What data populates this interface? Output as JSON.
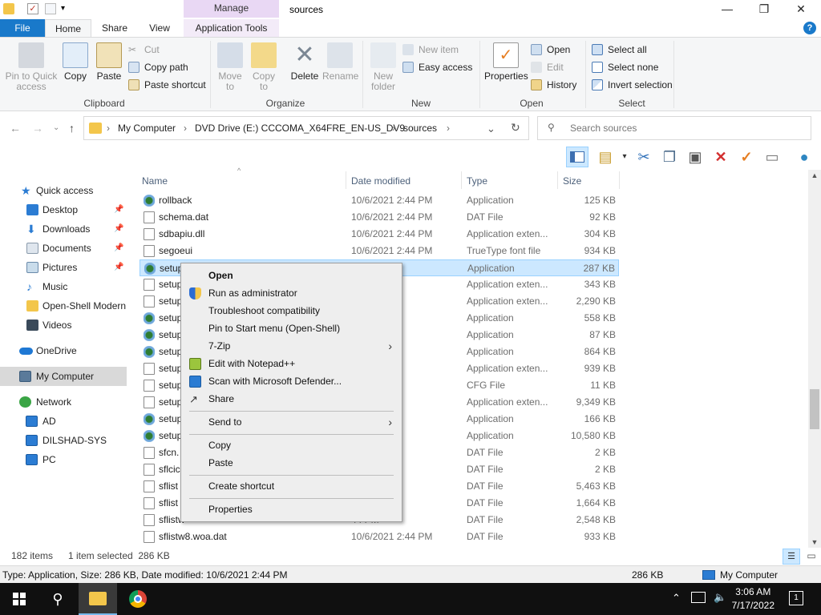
{
  "window": {
    "title": "sources",
    "contextual_tab_header": "Manage",
    "minimize_icon": "—",
    "maximize_icon": "❐",
    "close_icon": "✕",
    "help_icon": "?"
  },
  "ribbon_tabs": [
    "File",
    "Home",
    "Share",
    "View",
    "Application Tools"
  ],
  "ribbon": {
    "clipboard": {
      "label": "Clipboard",
      "pin_quick_access": "Pin to Quick access",
      "copy": "Copy",
      "paste": "Paste",
      "cut": "Cut",
      "copy_path": "Copy path",
      "paste_shortcut": "Paste shortcut"
    },
    "organize": {
      "label": "Organize",
      "move_to": "Move to",
      "copy_to": "Copy to",
      "delete": "Delete",
      "rename": "Rename"
    },
    "new": {
      "label": "New",
      "new_folder": "New folder",
      "new_item": "New item",
      "easy_access": "Easy access"
    },
    "open": {
      "label": "Open",
      "properties": "Properties",
      "open": "Open",
      "edit": "Edit",
      "history": "History"
    },
    "select": {
      "label": "Select",
      "select_all": "Select all",
      "select_none": "Select none",
      "invert_selection": "Invert selection"
    }
  },
  "address": {
    "crumbs": [
      "My Computer",
      "DVD Drive (E:) CCCOMA_X64FRE_EN-US_DV9",
      "sources"
    ],
    "search_placeholder": "Search sources"
  },
  "nav_pane": {
    "items": [
      {
        "label": "Quick access",
        "icon": "star-icon"
      },
      {
        "label": "Desktop",
        "icon": "desktop-icon"
      },
      {
        "label": "Downloads",
        "icon": "download-icon"
      },
      {
        "label": "Documents",
        "icon": "documents-icon"
      },
      {
        "label": "Pictures",
        "icon": "pictures-icon"
      },
      {
        "label": "Music",
        "icon": "music-icon"
      },
      {
        "label": "Open-Shell Modern",
        "icon": "folder-icon"
      },
      {
        "label": "Videos",
        "icon": "videos-icon"
      },
      {
        "label": "OneDrive",
        "icon": "cloud-icon"
      },
      {
        "label": "My Computer",
        "icon": "computer-icon"
      },
      {
        "label": "Network",
        "icon": "network-icon"
      },
      {
        "label": "AD",
        "icon": "monitor-icon"
      },
      {
        "label": "DILSHAD-SYS",
        "icon": "monitor-icon"
      },
      {
        "label": "PC",
        "icon": "monitor-icon"
      }
    ]
  },
  "file_list": {
    "columns": [
      "Name",
      "Date modified",
      "Type",
      "Size"
    ],
    "rows": [
      {
        "name": "rollback",
        "date": "10/6/2021 2:44 PM",
        "type": "Application",
        "size": "125 KB"
      },
      {
        "name": "schema.dat",
        "date": "10/6/2021 2:44 PM",
        "type": "DAT File",
        "size": "92 KB"
      },
      {
        "name": "sdbapiu.dll",
        "date": "10/6/2021 2:44 PM",
        "type": "Application exten...",
        "size": "304 KB"
      },
      {
        "name": "segoeui",
        "date": "10/6/2021 2:44 PM",
        "type": "TrueType font file",
        "size": "934 KB"
      },
      {
        "name": "setup",
        "date": "44 PM",
        "type": "Application",
        "size": "287 KB"
      },
      {
        "name": "setup",
        "date": "44 PM",
        "type": "Application exten...",
        "size": "343 KB"
      },
      {
        "name": "setup",
        "date": "44 PM",
        "type": "Application exten...",
        "size": "2,290 KB"
      },
      {
        "name": "setup",
        "date": "44 PM",
        "type": "Application",
        "size": "558 KB"
      },
      {
        "name": "setup",
        "date": "44 PM",
        "type": "Application",
        "size": "87 KB"
      },
      {
        "name": "setup",
        "date": "44 PM",
        "type": "Application",
        "size": "864 KB"
      },
      {
        "name": "setup",
        "date": "44 PM",
        "type": "Application exten...",
        "size": "939 KB"
      },
      {
        "name": "setup",
        "date": "44 PM",
        "type": "CFG File",
        "size": "11 KB"
      },
      {
        "name": "setup",
        "date": "44 PM",
        "type": "Application exten...",
        "size": "9,349 KB"
      },
      {
        "name": "setup",
        "date": "44 PM",
        "type": "Application",
        "size": "166 KB"
      },
      {
        "name": "setup",
        "date": "44 PM",
        "type": "Application",
        "size": "10,580 KB"
      },
      {
        "name": "sfcn.",
        "date": "44 PM",
        "type": "DAT File",
        "size": "2 KB"
      },
      {
        "name": "sflcic",
        "date": "44 PM",
        "type": "DAT File",
        "size": "2 KB"
      },
      {
        "name": "sflist",
        "date": "44 PM",
        "type": "DAT File",
        "size": "5,463 KB"
      },
      {
        "name": "sflist",
        "date": "44 PM",
        "type": "DAT File",
        "size": "1,664 KB"
      },
      {
        "name": "sflistw",
        "date": "44 PM",
        "type": "DAT File",
        "size": "2,548 KB"
      },
      {
        "name": "sflistw8.woa.dat",
        "date": "10/6/2021 2:44 PM",
        "type": "DAT File",
        "size": "933 KB"
      }
    ]
  },
  "context_menu": {
    "items": [
      {
        "label": "Open",
        "bold": true
      },
      {
        "label": "Run as administrator",
        "icon": "shield-icon"
      },
      {
        "label": "Troubleshoot compatibility"
      },
      {
        "label": "Pin to Start menu (Open-Shell)"
      },
      {
        "label": "7-Zip",
        "submenu": true
      },
      {
        "label": "Edit with Notepad++",
        "icon": "notepad-icon"
      },
      {
        "label": "Scan with Microsoft Defender...",
        "icon": "defender-icon"
      },
      {
        "label": "Share",
        "icon": "share-icon"
      },
      {
        "label": "Send to",
        "submenu": true
      },
      {
        "label": "Copy"
      },
      {
        "label": "Paste"
      },
      {
        "label": "Create shortcut"
      },
      {
        "label": "Properties"
      }
    ],
    "submenu_arrow": "›"
  },
  "status": {
    "item_count": "182 items",
    "selected": "1 item selected  286 KB"
  },
  "details_bar": {
    "info": "Type: Application, Size: 286 KB, Date modified: 10/6/2021 2:44 PM",
    "size": "286 KB",
    "location": "My Computer"
  },
  "taskbar": {
    "time": "3:06 AM",
    "date": "7/17/2022",
    "notification_count": "1"
  },
  "colors": {
    "file_tab": "#1979ca",
    "selection": "#cce8ff",
    "context_tab": "#e9d8f4",
    "taskbar": "#101010"
  }
}
